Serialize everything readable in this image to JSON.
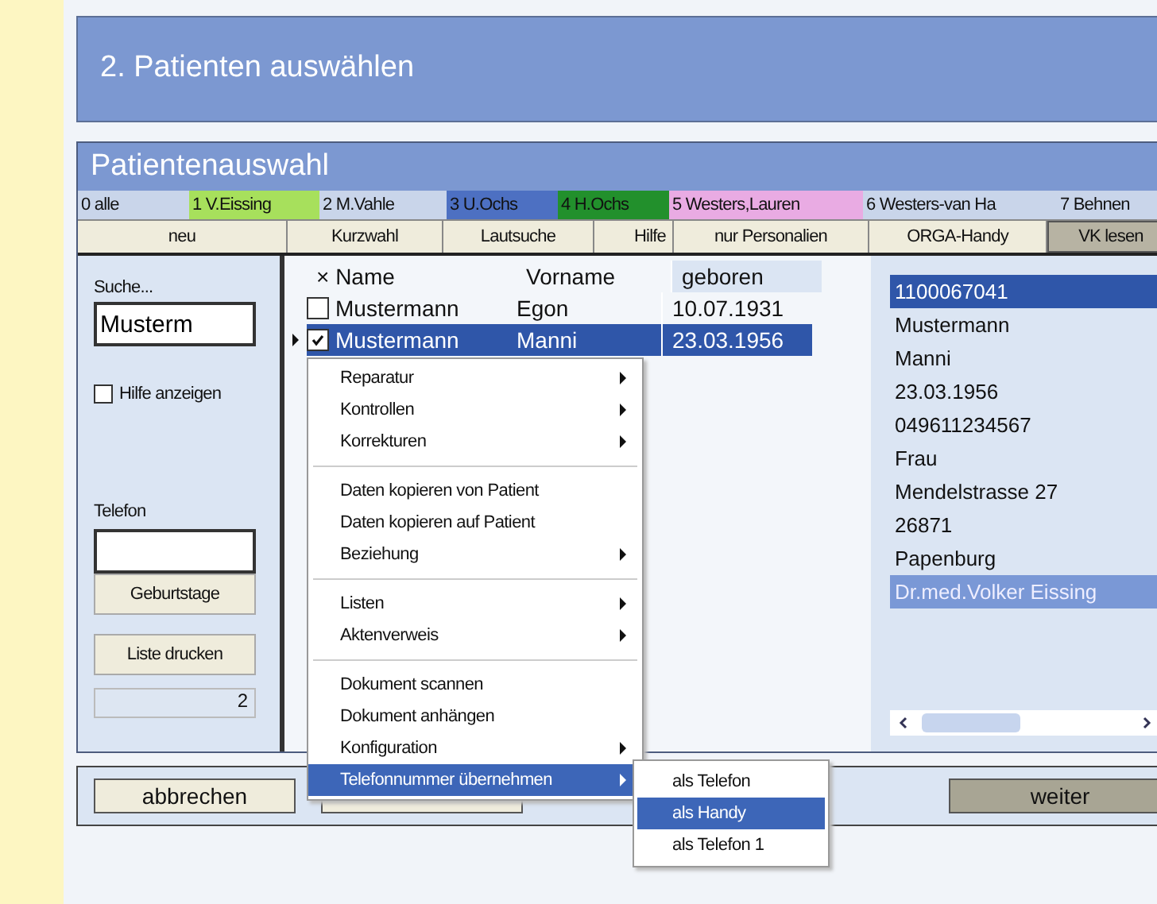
{
  "header": {
    "title": "2. Patienten auswählen"
  },
  "window": {
    "title": "Patientenauswahl"
  },
  "tabs": [
    {
      "label": "0 alle",
      "color": "#c9d5ea"
    },
    {
      "label": "1 V.Eissing",
      "color": "#a7e05c"
    },
    {
      "label": "2 M.Vahle",
      "color": "#c9d5ea"
    },
    {
      "label": "3 U.Ochs",
      "color": "#4d70c2"
    },
    {
      "label": "4 H.Ochs",
      "color": "#22902c"
    },
    {
      "label": "5 Westers,Lauren",
      "color": "#e9abe3"
    },
    {
      "label": "6 Westers-van Ha",
      "color": "#c9d5ea"
    },
    {
      "label": "7 Behnen",
      "color": "#c9d5ea"
    }
  ],
  "toolbar": [
    {
      "label": "neu",
      "pressed": false
    },
    {
      "label": "Kurzwahl",
      "pressed": false
    },
    {
      "label": "Lautsuche",
      "pressed": false
    },
    {
      "label": "Hilfe",
      "pressed": false
    },
    {
      "label": "nur Personalien",
      "pressed": false
    },
    {
      "label": "ORGA-Handy",
      "pressed": false
    },
    {
      "label": "VK lesen",
      "pressed": true
    }
  ],
  "search": {
    "label": "Suche...",
    "value": "Musterm",
    "help_checkbox": {
      "label": "Hilfe anzeigen",
      "checked": false
    },
    "phone_label": "Telefon",
    "birthdays_button": "Geburtstage",
    "print_button": "Liste drucken",
    "count": "2"
  },
  "table": {
    "columns": [
      "× Name",
      "Vorname",
      "geboren"
    ],
    "rows": [
      {
        "cells": [
          "Mustermann",
          "Egon",
          "10.07.1931"
        ],
        "checked": false,
        "selected": false,
        "current": false
      },
      {
        "cells": [
          "Mustermann",
          "Manni",
          "23.03.1956"
        ],
        "checked": true,
        "selected": true,
        "current": true
      }
    ]
  },
  "details": [
    {
      "text": "1100067041",
      "selected": true,
      "focused": true
    },
    {
      "text": "Mustermann",
      "selected": false,
      "focused": false
    },
    {
      "text": "Manni",
      "selected": false,
      "focused": false
    },
    {
      "text": "23.03.1956",
      "selected": false,
      "focused": false
    },
    {
      "text": "049611234567",
      "selected": false,
      "focused": false
    },
    {
      "text": "Frau",
      "selected": false,
      "focused": false
    },
    {
      "text": "Mendelstrasse 27",
      "selected": false,
      "focused": false
    },
    {
      "text": "26871",
      "selected": false,
      "focused": false
    },
    {
      "text": "Papenburg",
      "selected": false,
      "focused": false
    },
    {
      "text": "Dr.med.Volker Eissing",
      "selected": true,
      "focused": false
    }
  ],
  "footer_buttons": [
    {
      "label": "abbrechen",
      "pressed": false
    },
    {
      "pressed": false
    },
    {
      "label": "weiter",
      "pressed": true
    }
  ],
  "context_menu": {
    "groups": [
      [
        {
          "label": "Reparatur",
          "submenu": true,
          "selected": false
        },
        {
          "label": "Kontrollen",
          "submenu": true,
          "selected": false
        },
        {
          "label": "Korrekturen",
          "submenu": true,
          "selected": false
        }
      ],
      [
        {
          "label": "Daten kopieren von Patient",
          "submenu": false,
          "selected": false
        },
        {
          "label": "Daten kopieren auf Patient",
          "submenu": false,
          "selected": false
        },
        {
          "label": "Beziehung",
          "submenu": true,
          "selected": false
        }
      ],
      [
        {
          "label": "Listen",
          "submenu": true,
          "selected": false
        },
        {
          "label": "Aktenverweis",
          "submenu": true,
          "selected": false
        }
      ],
      [
        {
          "label": "Dokument scannen",
          "submenu": false,
          "selected": false
        },
        {
          "label": "Dokument anhängen",
          "submenu": false,
          "selected": false
        },
        {
          "label": "Konfiguration",
          "submenu": true,
          "selected": false
        },
        {
          "label": "Telefonnummer übernehmen",
          "submenu": true,
          "selected": true
        }
      ]
    ]
  },
  "submenu": [
    {
      "label": "als Telefon",
      "selected": false
    },
    {
      "label": "als Handy",
      "selected": true
    },
    {
      "label": "als Telefon 1",
      "selected": false
    }
  ]
}
